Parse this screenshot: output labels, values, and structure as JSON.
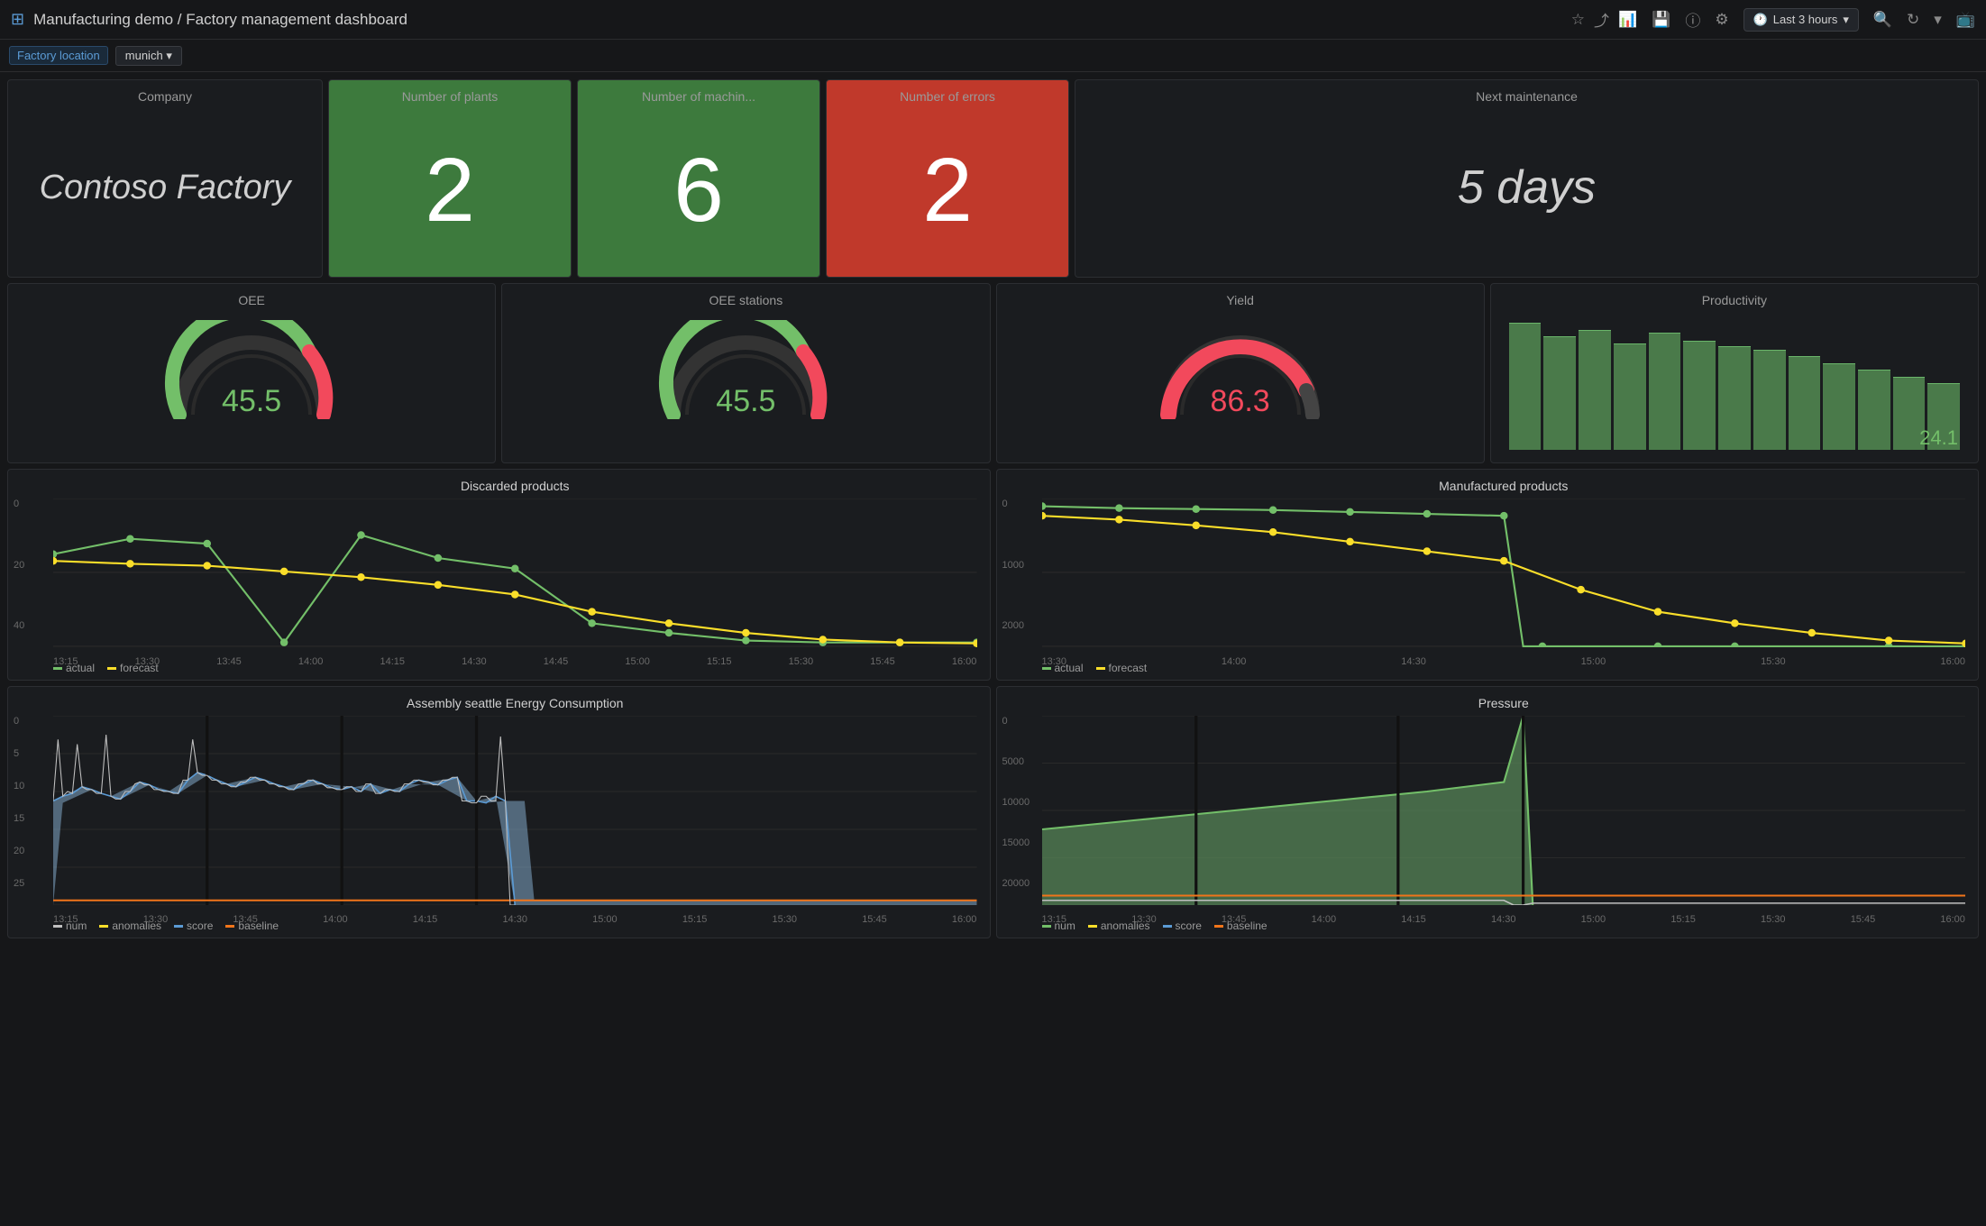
{
  "app": {
    "title": "Manufacturing demo / Factory management dashboard"
  },
  "topbar": {
    "title": "Manufacturing demo / Factory management dashboard",
    "time_range": "Last 3 hours"
  },
  "filterbar": {
    "label": "Factory location",
    "value": "munich"
  },
  "stats": {
    "company_label": "Company",
    "company_name": "Contoso Factory",
    "plants_label": "Number of plants",
    "plants_value": "2",
    "machines_label": "Number of machin...",
    "machines_value": "6",
    "errors_label": "Number of errors",
    "errors_value": "2",
    "maintenance_label": "Next maintenance",
    "maintenance_value": "5 days"
  },
  "gauges": {
    "oee_label": "OEE",
    "oee_value": "45.5",
    "oee_stations_label": "OEE stations",
    "oee_stations_value": "45.5",
    "yield_label": "Yield",
    "yield_value": "86.3",
    "productivity_label": "Productivity",
    "productivity_value": "24.1"
  },
  "charts": {
    "discarded_title": "Discarded products",
    "manufactured_title": "Manufactured products",
    "energy_title": "Assembly seattle Energy Consumption",
    "pressure_title": "Pressure",
    "legend_actual": "actual",
    "legend_forecast": "forecast",
    "legend_num": "num",
    "legend_anomalies": "anomalies",
    "legend_score": "score",
    "legend_baseline": "baseline",
    "discarded_y": [
      "0",
      "20",
      "40"
    ],
    "discarded_x": [
      "13:15",
      "13:30",
      "13:45",
      "14:00",
      "14:15",
      "14:30",
      "14:45",
      "15:00",
      "15:15",
      "15:30",
      "15:45",
      "16:00"
    ],
    "manufactured_y": [
      "0",
      "1000",
      "2000"
    ],
    "manufactured_x": [
      "13:30",
      "14:00",
      "14:30",
      "15:00",
      "15:30",
      "16:00"
    ],
    "energy_y": [
      "0",
      "5",
      "10",
      "15",
      "20",
      "25"
    ],
    "energy_x": [
      "13:15",
      "13:30",
      "13:45",
      "14:00",
      "14:15",
      "14:30",
      "15:00",
      "15:15",
      "15:30",
      "15:45",
      "16:00"
    ],
    "pressure_y": [
      "0",
      "5000",
      "10000",
      "15000",
      "20000"
    ],
    "pressure_x": [
      "13:15",
      "13:30",
      "13:45",
      "14:00",
      "14:15",
      "14:30",
      "15:00",
      "15:15",
      "15:30",
      "15:45",
      "16:00"
    ]
  }
}
